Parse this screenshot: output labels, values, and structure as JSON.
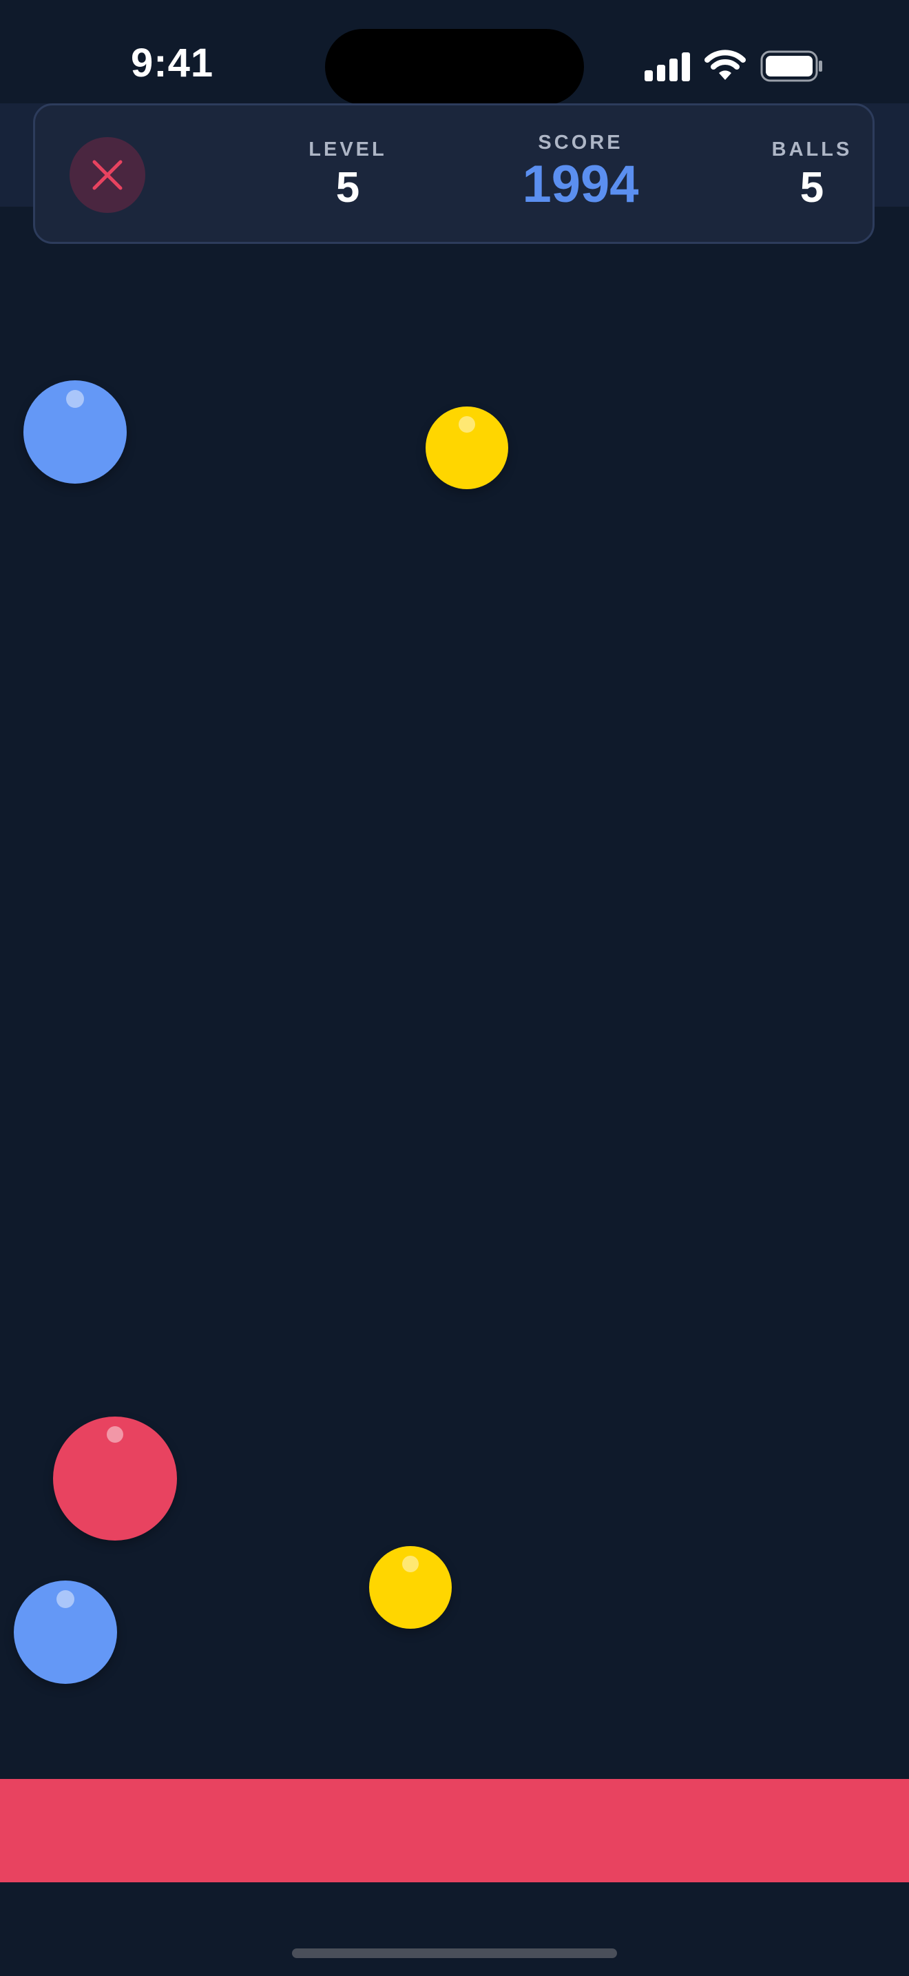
{
  "status_bar": {
    "time": "9:41",
    "icons": [
      "cellular-signal-icon",
      "wifi-icon",
      "battery-icon"
    ]
  },
  "hud": {
    "close_icon": "close-icon",
    "level_label": "LEVEL",
    "level_value": "5",
    "score_label": "SCORE",
    "score_value": "1994",
    "balls_label": "BALLS",
    "balls_value": "5"
  },
  "colors": {
    "background": "#0f1a2b",
    "hud_card": "#1b263c",
    "score_accent": "#5b8ff0",
    "close_accent": "#e84360",
    "paddle": "#e84360",
    "ball_blue": "#6498f6",
    "ball_yellow": "#ffd600",
    "ball_red": "#e84360"
  },
  "balls": [
    {
      "color": "blue"
    },
    {
      "color": "yellow"
    },
    {
      "color": "red"
    },
    {
      "color": "yellow"
    },
    {
      "color": "blue"
    }
  ],
  "paddle": {
    "color": "red"
  }
}
